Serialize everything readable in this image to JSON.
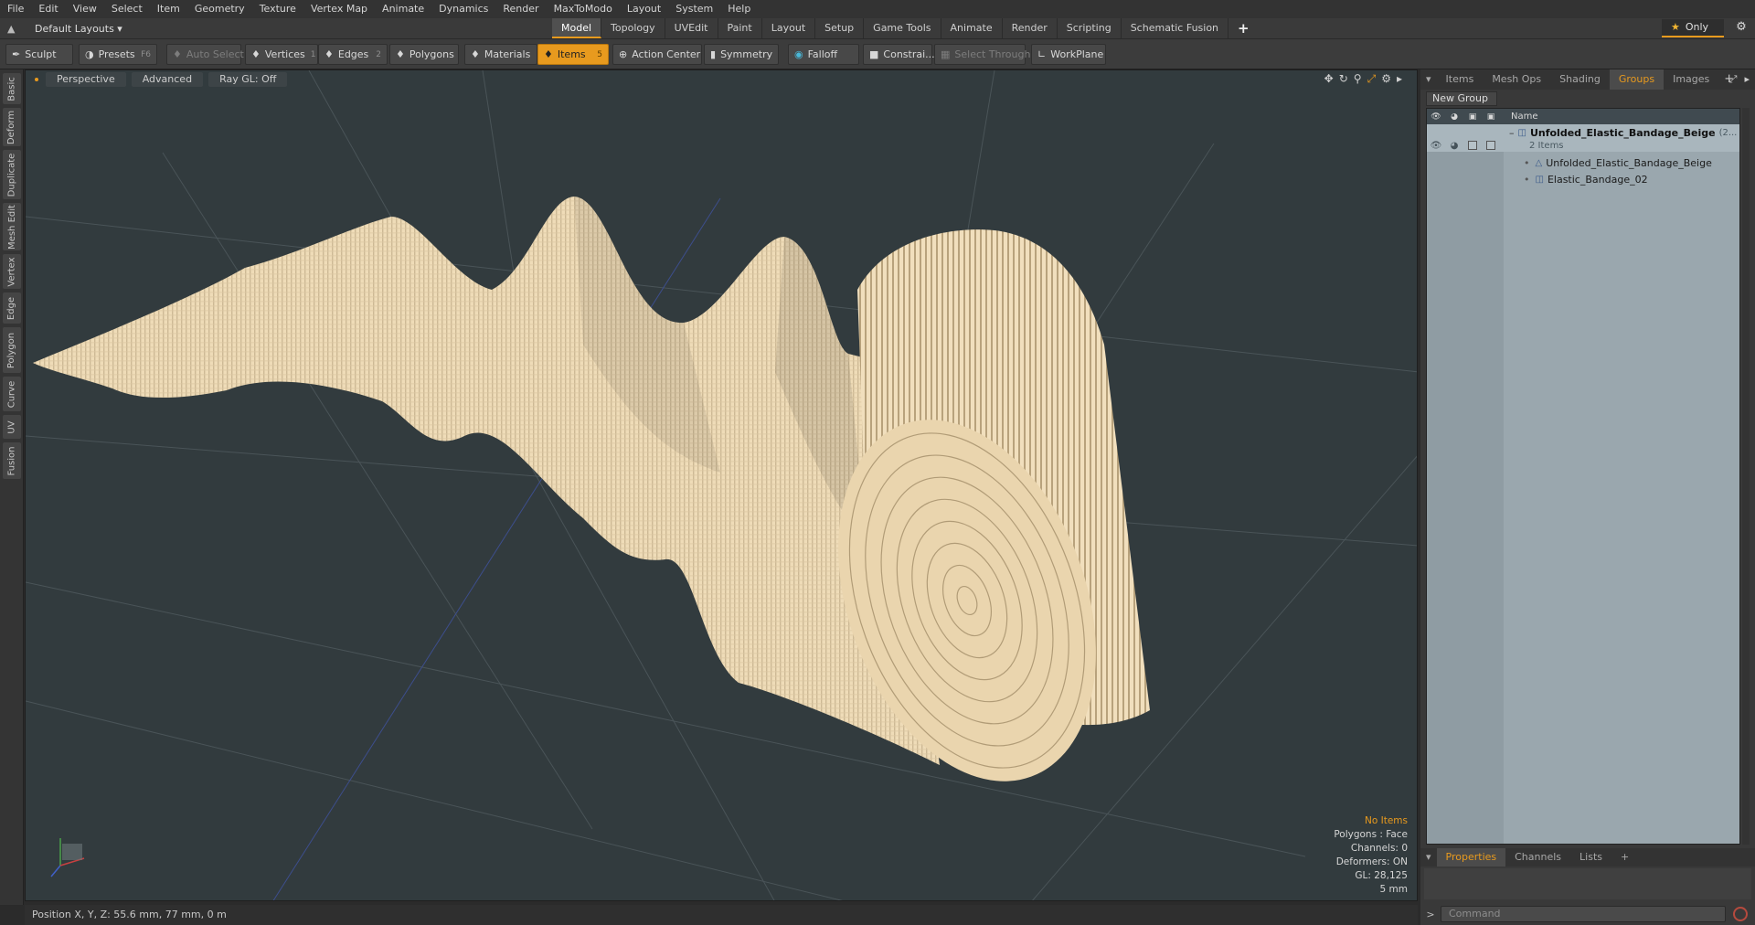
{
  "menu": [
    "File",
    "Edit",
    "View",
    "Select",
    "Item",
    "Geometry",
    "Texture",
    "Vertex Map",
    "Animate",
    "Dynamics",
    "Render",
    "MaxToModo",
    "Layout",
    "System",
    "Help"
  ],
  "layout": {
    "label": "Default Layouts ▾"
  },
  "mode_tabs": [
    "Model",
    "Topology",
    "UVEdit",
    "Paint",
    "Layout",
    "Setup",
    "Game Tools",
    "Animate",
    "Render",
    "Scripting",
    "Schematic Fusion"
  ],
  "only_label": "Only",
  "toolbar": {
    "sculpt": "Sculpt",
    "presets": "Presets",
    "presets_key": "F6",
    "auto_select": "Auto Select",
    "vertices": "Vertices",
    "vertices_key": "1",
    "edges": "Edges",
    "edges_key": "2",
    "polygons": "Polygons",
    "materials": "Materials",
    "items": "Items",
    "items_key": "5",
    "action_center": "Action Center",
    "symmetry": "Symmetry",
    "falloff": "Falloff",
    "constraints": "Constrai...",
    "select_through": "Select Through",
    "workplane": "WorkPlane"
  },
  "left_tabs": [
    "Basic",
    "Deform",
    "Duplicate",
    "Mesh Edit",
    "Vertex",
    "Edge",
    "Polygon",
    "Curve",
    "UV",
    "Fusion"
  ],
  "viewport": {
    "view": "Perspective",
    "shading": "Advanced",
    "raygl": "Ray GL: Off",
    "stats": {
      "no_items": "No Items",
      "polygons": "Polygons : Face",
      "channels": "Channels: 0",
      "deformers": "Deformers: ON",
      "gl": "GL: 28,125",
      "scale": "5 mm"
    }
  },
  "status": {
    "position": "Position X, Y, Z:   55.6 mm, 77 mm, 0 m"
  },
  "right_panel": {
    "tabs": [
      "Items",
      "Mesh Ops",
      "Shading",
      "Groups",
      "Images"
    ],
    "active_tab": "Groups",
    "new_group": "New Group",
    "name_header": "Name",
    "group_name": "Unfolded_Elastic_Bandage_Beige",
    "group_suffix": "(2...",
    "group_count": "2 Items",
    "children": [
      "Unfolded_Elastic_Bandage_Beige",
      "Elastic_Bandage_02"
    ],
    "bottom_tabs": [
      "Properties",
      "Channels",
      "Lists"
    ],
    "command_placeholder": "Command"
  },
  "colors": {
    "accent": "#e89a1e",
    "viewport_bg": "#323b3e",
    "bandage": "#efdcb8",
    "bandage_shadow": "#a8946f"
  }
}
